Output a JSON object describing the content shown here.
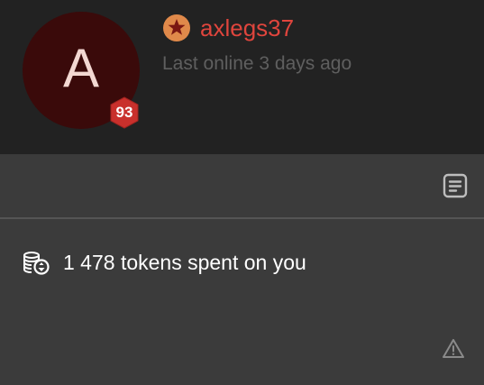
{
  "profile": {
    "avatar_letter": "A",
    "level": "93",
    "username": "axlegs37",
    "last_online": "Last online 3 days ago",
    "rank_icon": "star-badge-icon"
  },
  "stats": {
    "tokens_text": "1 478 tokens spent on you",
    "tokens_icon": "coins-icon"
  },
  "actions": {
    "report_icon": "document-icon",
    "warning_icon": "warning-icon"
  },
  "colors": {
    "header_bg": "#222222",
    "body_bg": "#3b3b3b",
    "avatar_bg": "#3a0a0a",
    "username": "#e0453d",
    "badge": "#c9302c",
    "rank_badge": "#e0894a"
  }
}
